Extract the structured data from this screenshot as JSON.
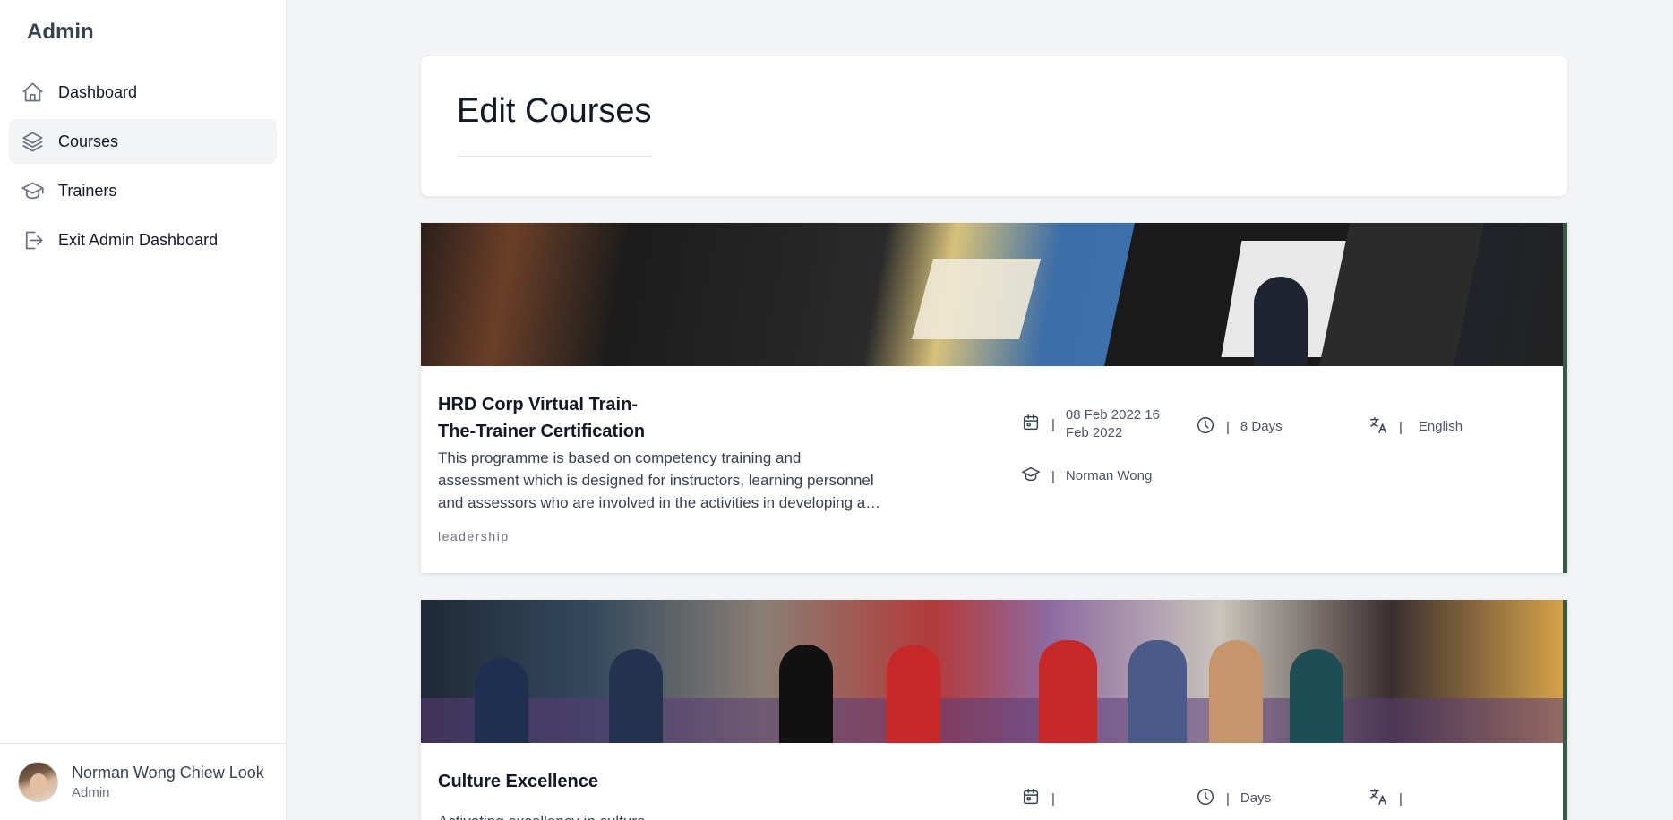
{
  "sidebar": {
    "brand": "Admin",
    "items": [
      {
        "label": "Dashboard",
        "icon": "home-icon"
      },
      {
        "label": "Courses",
        "icon": "layers-icon"
      },
      {
        "label": "Trainers",
        "icon": "graduation-cap-icon"
      },
      {
        "label": "Exit Admin Dashboard",
        "icon": "exit-icon"
      }
    ],
    "active_item": "Courses"
  },
  "profile": {
    "name": "Norman Wong Chiew Look",
    "role": "Admin"
  },
  "header": {
    "title": "Edit Courses"
  },
  "courses": [
    {
      "title": "HRD Corp Virtual Train-The-Trainer Certification",
      "description": "This programme is based on competency training and assessment which is designed for instructors, learning personnel and assessors who are involved in the activities in developing a…",
      "tag": "leadership",
      "date": "08 Feb 2022 16 Feb 2022",
      "duration": "8 Days",
      "language": "English",
      "trainer": "Norman Wong"
    },
    {
      "title": "Culture Excellence",
      "description": "Activating excellency in culture",
      "date": "",
      "duration": "Days",
      "language": ""
    }
  ],
  "colors": {
    "card_accent": "#2f5d45",
    "background": "#f3f4f6"
  }
}
